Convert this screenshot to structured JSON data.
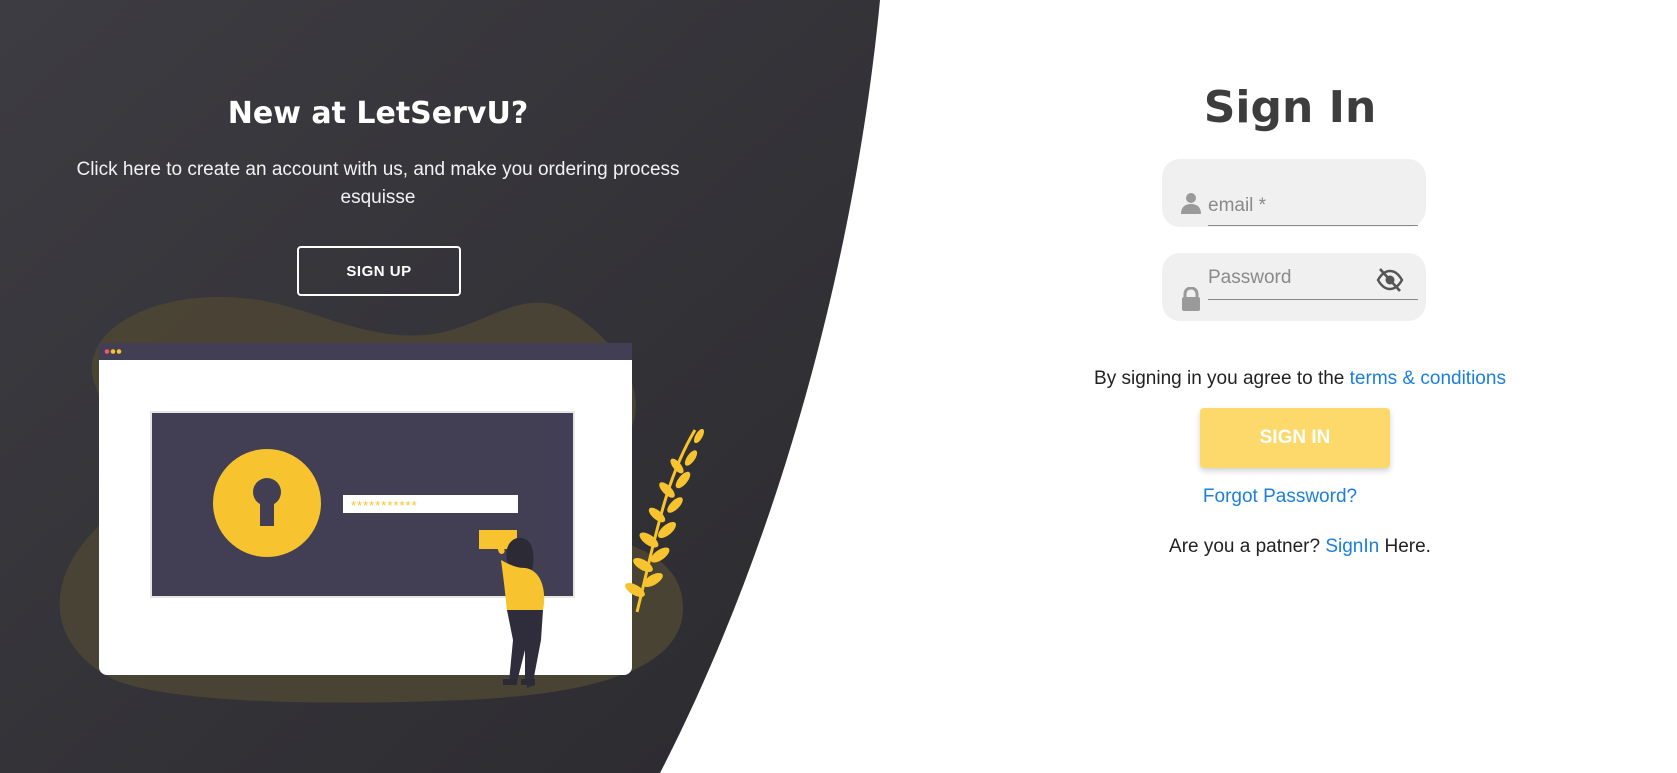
{
  "left_panel": {
    "title": "New at LetServU?",
    "description": "Click here to create an account with us, and make you ordering process esquisse",
    "signup_label": "SIGN UP",
    "password_mask": "***********"
  },
  "signin": {
    "title": "Sign In",
    "email_placeholder": "email *",
    "password_placeholder": "Password",
    "terms_prefix": "By signing in you agree to the ",
    "terms_link": "terms & conditions",
    "signin_label": "SIGN IN",
    "forgot_label": "Forgot Password?",
    "partner_prefix": "Are you a patner? ",
    "partner_link": "SignIn",
    "partner_suffix": " Here."
  },
  "icons": {
    "email_field": "person-icon",
    "password_field": "lock-icon",
    "password_toggle": "eye-off-icon"
  },
  "colors": {
    "dark_bg": "#38373c",
    "accent_yellow": "#fdd86a",
    "illustration_yellow": "#f7c32e",
    "illustration_navy": "#423f55",
    "link_blue": "#1a7fe0",
    "field_bg": "#f0f0f0"
  }
}
